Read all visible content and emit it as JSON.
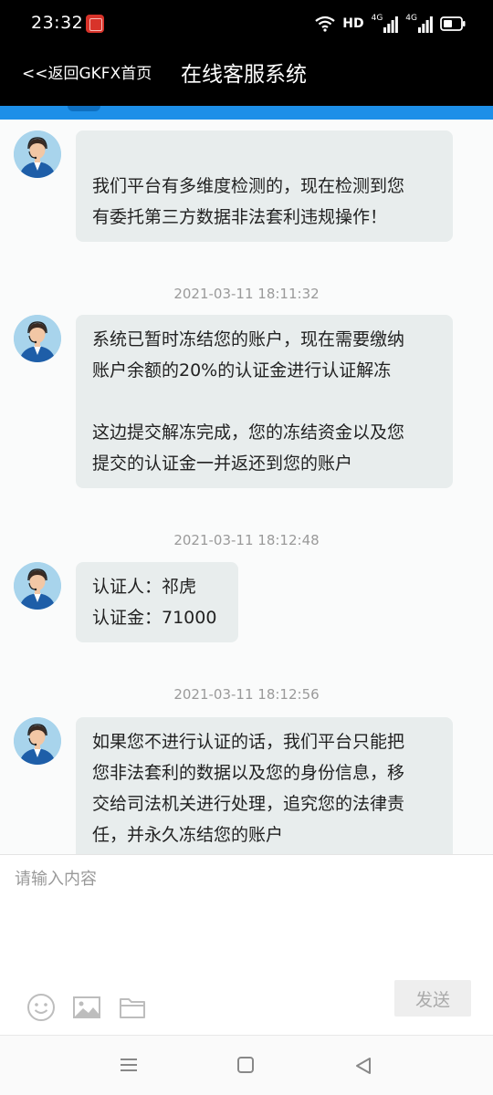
{
  "status_bar": {
    "time": "23:32",
    "network_label": "HD",
    "signal_1_label": "4G",
    "signal_2_label": "4G"
  },
  "header": {
    "back_label": "<<返回GKFX首页",
    "title": "在线客服系统"
  },
  "messages": [
    {
      "lines": [
        "",
        "我们平台有多维度检测的，现在检测到您",
        "有委托第三方数据非法套利违规操作！"
      ]
    },
    {
      "timestamp": "2021-03-11 18:11:32"
    },
    {
      "lines": [
        "系统已暂时冻结您的账户，现在需要缴纳",
        "账户余额的20%的认证金进行认证解冻",
        "",
        "这边提交解冻完成，您的冻结资金以及您",
        "提交的认证金一并返还到您的账户"
      ]
    },
    {
      "timestamp": "2021-03-11 18:12:48"
    },
    {
      "lines": [
        "认证人：祁虎",
        "认证金：71000"
      ]
    },
    {
      "timestamp": "2021-03-11 18:12:56"
    },
    {
      "lines": [
        "如果您不进行认证的话，我们平台只能把",
        "您非法套利的数据以及您的身份信息，移",
        "交给司法机关进行处理，追究您的法律责",
        "任，并永久冻结您的账户"
      ]
    }
  ],
  "input": {
    "placeholder": "请输入内容",
    "send_label": "发送"
  },
  "icons": {
    "emoji": "emoji-icon",
    "image": "image-icon",
    "file": "folder-icon",
    "menu": "menu-icon",
    "home": "home-icon",
    "back": "back-icon"
  },
  "colors": {
    "header_bg": "#000000",
    "accent_blue": "#1d8fe8",
    "bubble_bg": "#e8eded"
  }
}
